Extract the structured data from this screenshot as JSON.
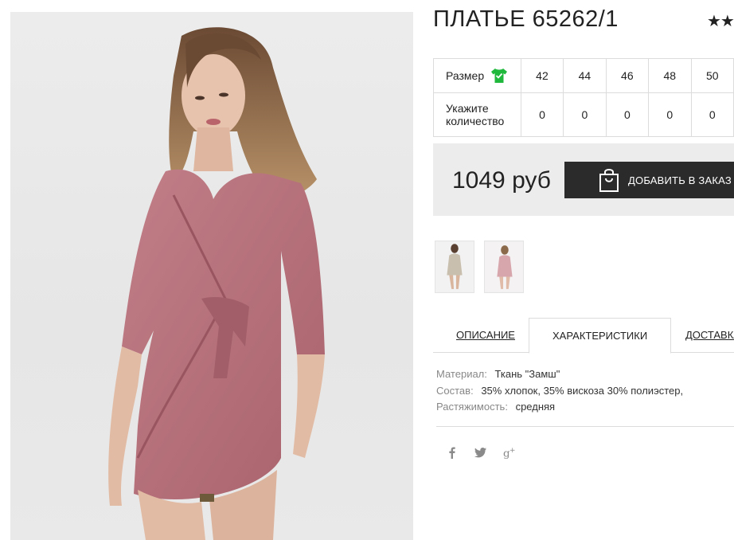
{
  "product": {
    "title": "ПЛАТЬЕ 65262/1",
    "rating_stars": "★★"
  },
  "size_table": {
    "size_label": "Размер",
    "qty_label": "Укажите количество",
    "sizes": [
      "42",
      "44",
      "46",
      "48",
      "50"
    ],
    "quantities": [
      "0",
      "0",
      "0",
      "0",
      "0"
    ]
  },
  "purchase": {
    "price": "1049 руб",
    "add_button_label": "ДОБАВИТЬ В ЗАКАЗ"
  },
  "tabs": [
    {
      "label": "ОПИСАНИЕ",
      "active": false
    },
    {
      "label": "ХАРАКТЕРИСТИКИ",
      "active": true
    },
    {
      "label": "ДОСТАВКА",
      "active": false
    }
  ],
  "specs": [
    {
      "key": "Материал:",
      "value": "Ткань \"Замш\""
    },
    {
      "key": "Состав:",
      "value": "35% хлопок, 35% вискоза 30% полиэстер,"
    },
    {
      "key": "Растяжимость:",
      "value": "средняя"
    }
  ],
  "social": [
    "facebook-icon",
    "twitter-icon",
    "google-plus-icon"
  ],
  "colors": {
    "dress": "#b8717b",
    "button_bg": "#2b2b2b",
    "price_bar_bg": "#ececec",
    "shirt_icon": "#1fb83c"
  }
}
